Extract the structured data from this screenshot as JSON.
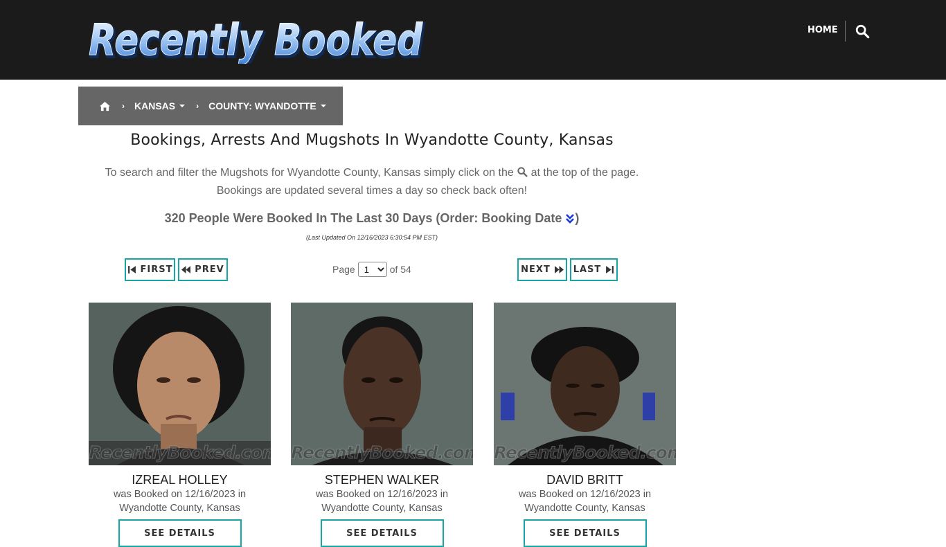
{
  "header": {
    "logo_text": "Recently Booked",
    "nav_home": "HOME",
    "search_icon": "search-icon"
  },
  "breadcrumb": {
    "home_icon": "home-icon",
    "state": "KANSAS",
    "county": "COUNTY: WYANDOTTE"
  },
  "main": {
    "title": "Bookings, Arrests And Mugshots In Wyandotte County, Kansas",
    "intro_before_icon": "To search and filter the Mugshots for Wyandotte County, Kansas simply click on the",
    "intro_after_icon": "at the top of the page.",
    "intro_line2": "Bookings are updated several times a day so check back often!",
    "count_text": "320 People Were Booked In The Last 30 Days (Order: Booking Date",
    "count_close": ")",
    "last_updated": "(Last Updated On 12/16/2023 6:30:54 PM EST)"
  },
  "pagination": {
    "first": "FIRST",
    "prev": "PREV",
    "next": "NEXT",
    "last": "LAST",
    "page_label": "Page",
    "current_page": "1",
    "of_label": "of 54"
  },
  "bookings": [
    {
      "name": "IZREAL HOLLEY",
      "booked_line": "was Booked on 12/16/2023 in",
      "location": "Wyandotte County, Kansas",
      "watermark": "RecentlyBooked.com",
      "details": "SEE DETAILS"
    },
    {
      "name": "STEPHEN WALKER",
      "booked_line": "was Booked on 12/16/2023 in",
      "location": "Wyandotte County, Kansas",
      "watermark": "RecentlyBooked.com",
      "details": "SEE DETAILS"
    },
    {
      "name": "DAVID BRITT",
      "booked_line": "was Booked on 12/16/2023 in",
      "location": "Wyandotte County, Kansas",
      "watermark": "RecentlyBooked.com",
      "details": "SEE DETAILS"
    }
  ],
  "colors": {
    "header_bg": "#1b1b1b",
    "breadcrumb_bg": "#666666",
    "accent_teal": "#1aa5a5",
    "sort_icon": "#1a3bd6"
  }
}
